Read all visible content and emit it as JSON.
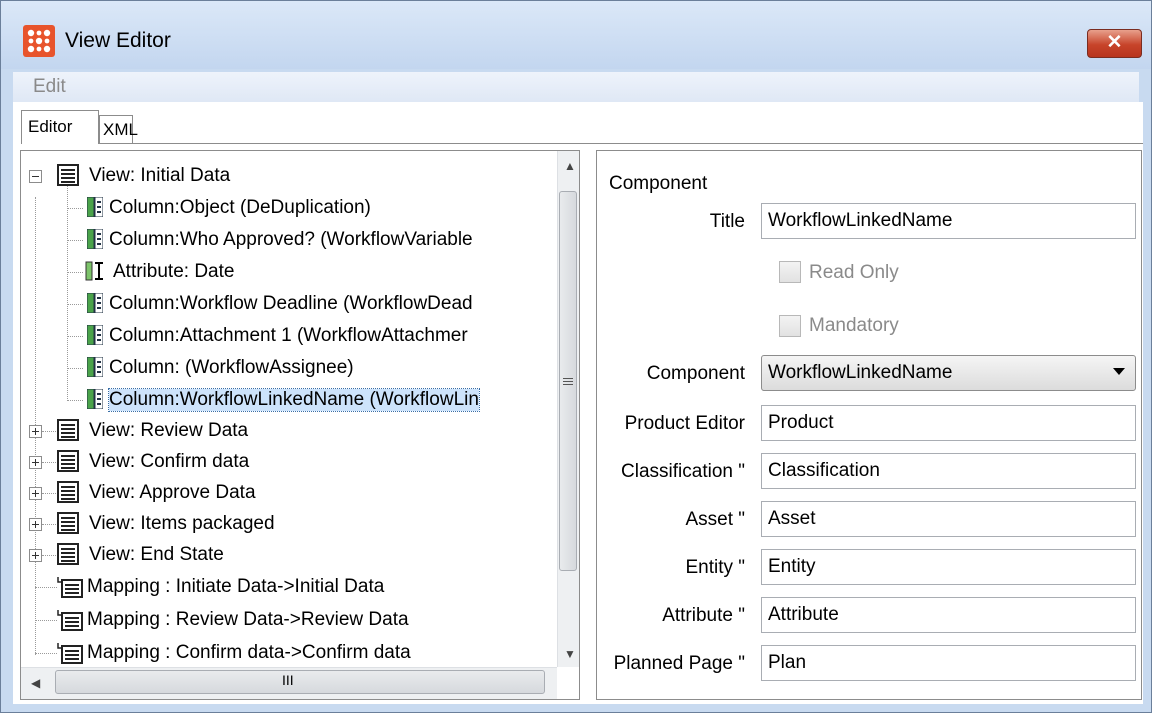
{
  "window": {
    "title": "View Editor",
    "close_glyph": "✕"
  },
  "menu": {
    "edit": "Edit"
  },
  "tabs": {
    "editor": "Editor",
    "xml": "XML"
  },
  "tree": {
    "root": "View: Initial Data",
    "children": [
      {
        "icon": "column-icon",
        "label": "Column:Object (DeDuplication)"
      },
      {
        "icon": "column-icon",
        "label": "Column:Who Approved? (WorkflowVariable"
      },
      {
        "icon": "attribute-icon",
        "label": "Attribute: Date"
      },
      {
        "icon": "column-icon",
        "label": "Column:Workflow Deadline (WorkflowDead"
      },
      {
        "icon": "column-icon",
        "label": "Column:Attachment 1 (WorkflowAttachmer"
      },
      {
        "icon": "column-icon",
        "label": "Column: (WorkflowAssignee)"
      },
      {
        "icon": "column-icon",
        "label": "Column:WorkflowLinkedName (WorkflowLin",
        "selected": true
      }
    ],
    "views": [
      {
        "label": "View: Review Data"
      },
      {
        "label": "View: Confirm data"
      },
      {
        "label": "View: Approve Data"
      },
      {
        "label": "View: Items packaged"
      },
      {
        "label": "View: End State"
      }
    ],
    "mappings": [
      {
        "label": "Mapping : Initiate Data->Initial Data"
      },
      {
        "label": "Mapping : Review Data->Review Data"
      },
      {
        "label": "Mapping : Confirm data->Confirm data"
      }
    ],
    "hscroll_grip": "III"
  },
  "component": {
    "heading": "Component",
    "title_label": "Title",
    "title_value": "WorkflowLinkedName",
    "read_only_label": "Read Only",
    "mandatory_label": "Mandatory",
    "component_label": "Component",
    "component_value": "WorkflowLinkedName",
    "fields": [
      {
        "label": "Product Editor",
        "value": "Product"
      },
      {
        "label": "Classification \"",
        "value": "Classification"
      },
      {
        "label": "Asset \"",
        "value": "Asset"
      },
      {
        "label": "Entity \"",
        "value": "Entity"
      },
      {
        "label": "Attribute \"",
        "value": "Attribute"
      },
      {
        "label": "Planned Page \"",
        "value": "Plan"
      }
    ]
  },
  "colors": {
    "selection": "#cde3fb",
    "window_frame": "#c8daf0",
    "close_button": "#c7442a"
  }
}
